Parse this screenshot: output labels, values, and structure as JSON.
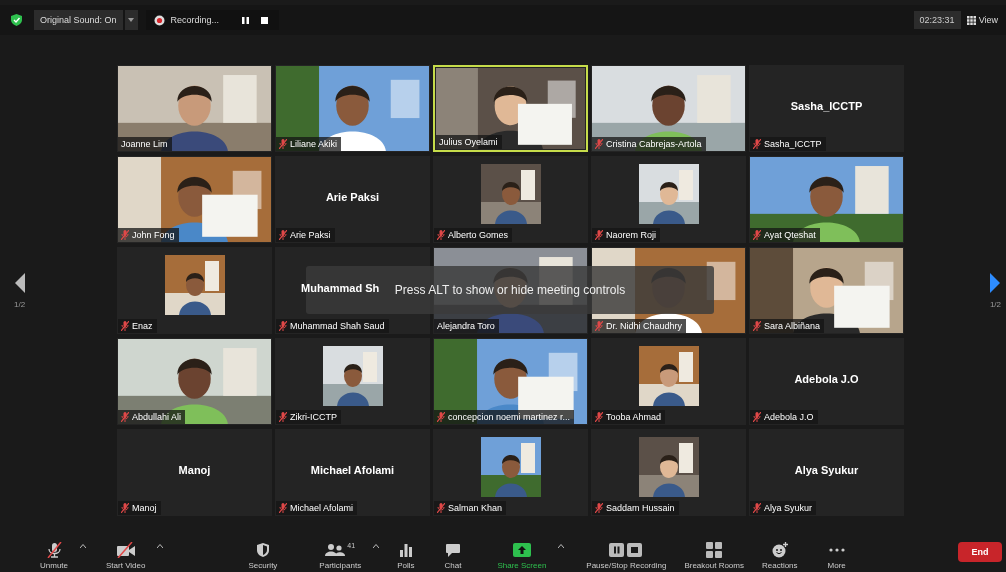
{
  "top_bar": {
    "original_sound": "Original Sound: On",
    "recording": "Recording...",
    "timer": "02:23:31",
    "view_button": "View"
  },
  "pager": {
    "left": {
      "label": "1/2",
      "enabled": false
    },
    "right": {
      "label": "1/2",
      "enabled": true
    }
  },
  "tiles": [
    {
      "name": "Joanne Lim",
      "kind": "video",
      "muted": false,
      "speaking": false
    },
    {
      "name": "Liliane Akiki",
      "kind": "video",
      "muted": true,
      "speaking": false
    },
    {
      "name": "Julius Oyelami",
      "kind": "video",
      "muted": false,
      "speaking": true
    },
    {
      "name": "Cristina Cabrejas-Artola",
      "kind": "video",
      "muted": true,
      "speaking": false
    },
    {
      "name": "Sasha_ICCTP",
      "kind": "name",
      "display_name": "Sasha_ICCTP",
      "muted": true,
      "speaking": false
    },
    {
      "name": "John Fong",
      "kind": "video",
      "muted": true,
      "speaking": false
    },
    {
      "name": "Arie Paksi",
      "kind": "name",
      "display_name": "Arie Paksi",
      "muted": true,
      "speaking": false
    },
    {
      "name": "Alberto Gomes",
      "muted": true,
      "speaking": false
    },
    {
      "name": "Naorem Roji",
      "muted": true,
      "speaking": false
    },
    {
      "name": "Ayat Qteshat",
      "kind": "video",
      "muted": true,
      "speaking": false
    },
    {
      "name": "Enaz",
      "muted": true,
      "speaking": false
    },
    {
      "name": "Muhammad Shah Saud",
      "kind": "name",
      "display_name": "Muhammad Sh",
      "muted": true,
      "speaking": false
    },
    {
      "name": "Alejandra Toro",
      "kind": "video",
      "muted": false,
      "speaking": false
    },
    {
      "name": "Dr. Nidhi Chaudhry",
      "kind": "video",
      "muted": true,
      "speaking": false
    },
    {
      "name": "Sara Albiñana",
      "kind": "video",
      "muted": true,
      "speaking": false
    },
    {
      "name": "Abdullahi Ali",
      "kind": "video",
      "muted": true,
      "speaking": false
    },
    {
      "name": "Zikri-ICCTP",
      "muted": true,
      "speaking": false
    },
    {
      "name": "concepcion noemi martinez r...",
      "kind": "video",
      "muted": true,
      "speaking": false
    },
    {
      "name": "Tooba Ahmad",
      "muted": true,
      "speaking": false
    },
    {
      "name": "Adebola J.O",
      "kind": "name",
      "display_name": "Adebola J.O",
      "muted": true,
      "speaking": false
    },
    {
      "name": "Manoj",
      "kind": "name",
      "display_name": "Manoj",
      "muted": true,
      "speaking": false
    },
    {
      "name": "Michael Afolami",
      "kind": "name",
      "display_name": "Michael Afolami",
      "muted": true,
      "speaking": false
    },
    {
      "name": "Salman Khan",
      "muted": true,
      "speaking": false
    },
    {
      "name": "Saddam Hussain",
      "muted": true,
      "speaking": false
    },
    {
      "name": "Alya Syukur",
      "kind": "name",
      "display_name": "Alya Syukur",
      "muted": true,
      "speaking": false
    }
  ],
  "overlay": {
    "message": "Press ALT to show or hide meeting controls"
  },
  "toolbar": {
    "items": [
      {
        "label": "Unmute",
        "kind": "mic-off",
        "caret": true
      },
      {
        "label": "Start Video",
        "kind": "video-off",
        "caret": true
      },
      {
        "label": "Security",
        "kind": "security",
        "caret": false
      },
      {
        "label": "Participants",
        "kind": "participants",
        "count": "41",
        "caret": true
      },
      {
        "label": "Polls",
        "kind": "polls",
        "caret": false
      },
      {
        "label": "Chat",
        "kind": "chat",
        "caret": false
      },
      {
        "label": "Share Screen",
        "kind": "share",
        "caret": true
      },
      {
        "label": "Pause/Stop Recording",
        "kind": "recording",
        "caret": false
      },
      {
        "label": "Breakout Rooms",
        "kind": "rooms",
        "caret": false
      },
      {
        "label": "Reactions",
        "kind": "reactions",
        "caret": false
      },
      {
        "label": "More",
        "kind": "more",
        "caret": false
      }
    ],
    "end_button": "End"
  }
}
